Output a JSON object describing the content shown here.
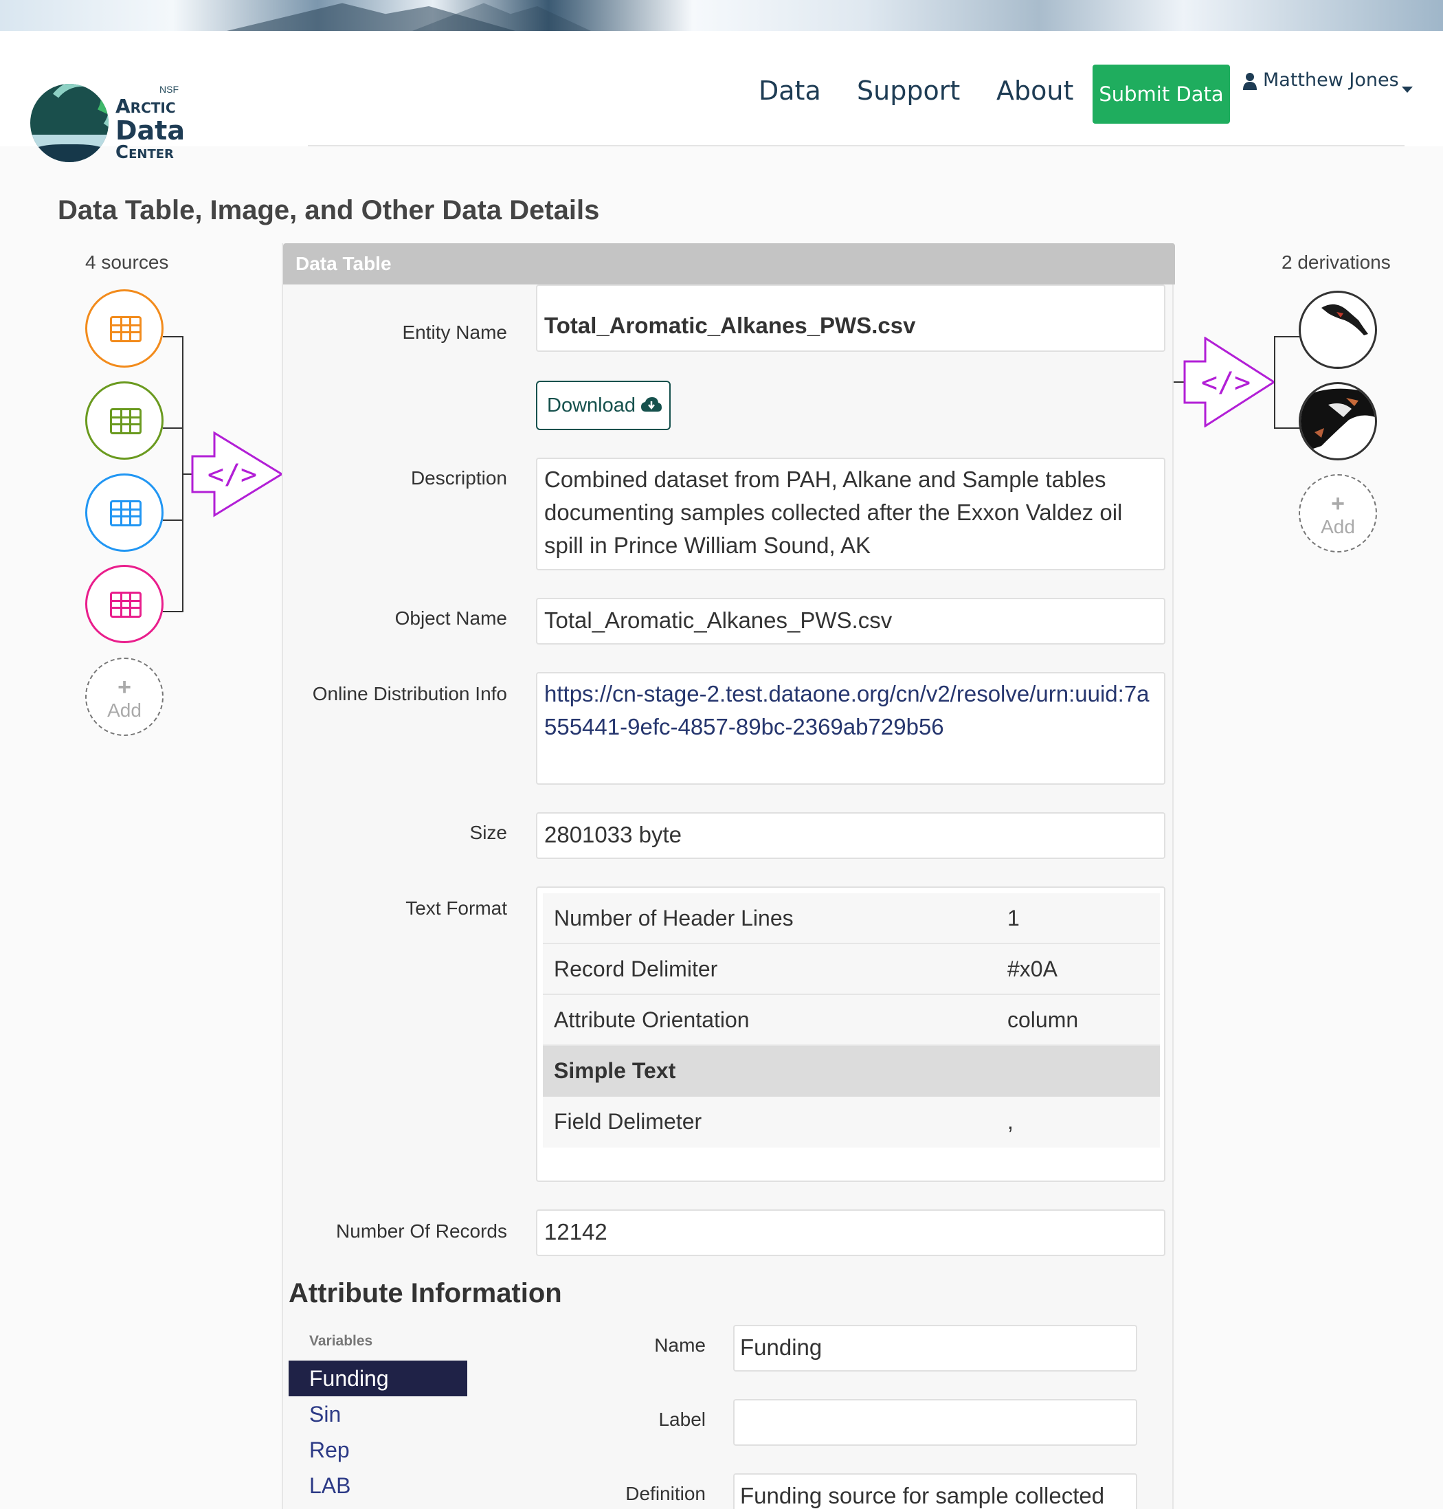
{
  "header": {
    "logo": {
      "nsf": "NSF",
      "line1": "Arctic",
      "line2": "Data",
      "line3": "Center"
    },
    "nav": [
      {
        "label": "Data"
      },
      {
        "label": "Support"
      },
      {
        "label": "About"
      }
    ],
    "submit_label": "Submit Data",
    "user_name": "Matthew Jones"
  },
  "page": {
    "title": "Data Table, Image, and Other Data Details"
  },
  "provenance": {
    "sources_label": "4 sources",
    "derivations_label": "2 derivations",
    "add_label": "Add",
    "source_colors": [
      "#f28b1c",
      "#6a9a1f",
      "#2196f3",
      "#e91e8c"
    ],
    "program_color": "#b21fd6"
  },
  "panel": {
    "heading": "Data Table",
    "entity_name_label": "Entity Name",
    "entity_name": "Total_Aromatic_Alkanes_PWS.csv",
    "download_label": "Download",
    "description_label": "Description",
    "description": "Combined dataset from PAH, Alkane and Sample tables documenting samples collected after the Exxon Valdez oil spill in Prince William Sound, AK",
    "object_name_label": "Object Name",
    "object_name": "Total_Aromatic_Alkanes_PWS.csv",
    "online_dist_label": "Online Distribution Info",
    "online_dist_url": "https://cn-stage-2.test.dataone.org/cn/v2/resolve/urn:uuid:7a555441-9efc-4857-89bc-2369ab729b56",
    "size_label": "Size",
    "size": "2801033 byte",
    "text_format_label": "Text Format",
    "text_format": [
      {
        "key": "Number of Header Lines",
        "value": "1"
      },
      {
        "key": "Record Delimiter",
        "value": "#x0A"
      },
      {
        "key": "Attribute Orientation",
        "value": "column"
      }
    ],
    "simple_text_label": "Simple Text",
    "field_delimiter": {
      "key": "Field Delimeter",
      "value": ","
    },
    "num_records_label": "Number Of Records",
    "num_records": "12142"
  },
  "attributes": {
    "title": "Attribute Information",
    "variables_label": "Variables",
    "variables": [
      "Funding",
      "Sin",
      "Rep",
      "LAB"
    ],
    "selected": {
      "name_label": "Name",
      "name": "Funding",
      "label_label": "Label",
      "label": "",
      "definition_label": "Definition",
      "definition": "Funding source for sample collected"
    }
  }
}
